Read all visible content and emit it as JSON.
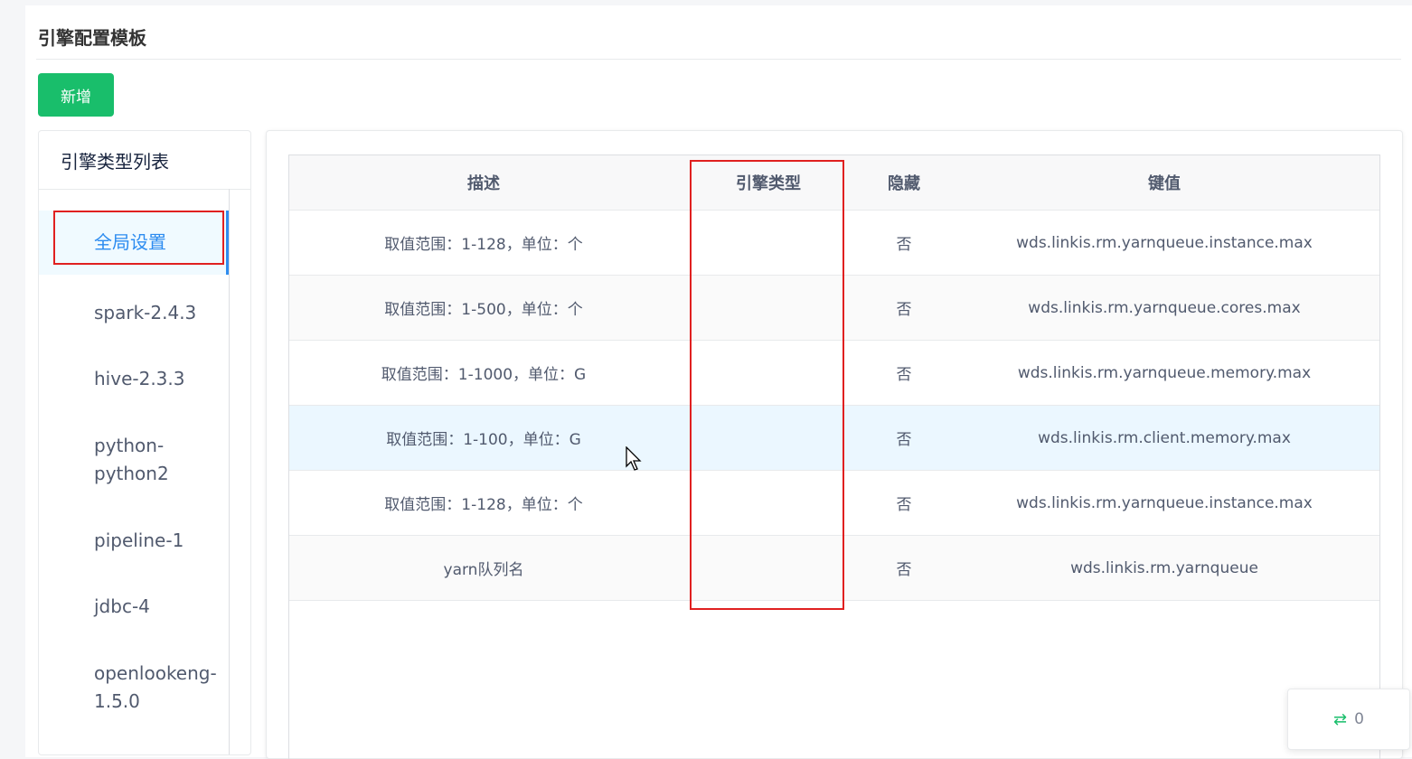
{
  "page": {
    "title": "引擎配置模板",
    "add_button": "新增"
  },
  "sidebar": {
    "header": "引擎类型列表",
    "items": [
      {
        "label": "全局设置"
      },
      {
        "label": "spark-2.4.3"
      },
      {
        "label": "hive-2.3.3"
      },
      {
        "label": "python-\npython2"
      },
      {
        "label": "pipeline-1"
      },
      {
        "label": "jdbc-4"
      },
      {
        "label": "openlookeng-\n1.5.0"
      }
    ],
    "active_index": 0
  },
  "table": {
    "columns": [
      "描述",
      "引擎类型",
      "隐藏",
      "键值"
    ],
    "rows": [
      {
        "desc": "取值范围：1-128，单位：个",
        "engine": "",
        "hidden": "否",
        "key": "wds.linkis.rm.yarnqueue.instance.max"
      },
      {
        "desc": "取值范围：1-500，单位：个",
        "engine": "",
        "hidden": "否",
        "key": "wds.linkis.rm.yarnqueue.cores.max"
      },
      {
        "desc": "取值范围：1-1000，单位：G",
        "engine": "",
        "hidden": "否",
        "key": "wds.linkis.rm.yarnqueue.memory.max"
      },
      {
        "desc": "取值范围：1-100，单位：G",
        "engine": "",
        "hidden": "否",
        "key": "wds.linkis.rm.client.memory.max"
      },
      {
        "desc": "取值范围：1-128，单位：个",
        "engine": "",
        "hidden": "否",
        "key": "wds.linkis.rm.yarnqueue.instance.max"
      },
      {
        "desc": "yarn队列名",
        "engine": "",
        "hidden": "否",
        "key": "wds.linkis.rm.yarnqueue"
      }
    ]
  },
  "float_badge": {
    "icon": "swap-arrows-icon",
    "count": "0"
  },
  "colors": {
    "primary": "#2d8cf0",
    "success": "#19be6b",
    "highlight": "#e02020"
  }
}
